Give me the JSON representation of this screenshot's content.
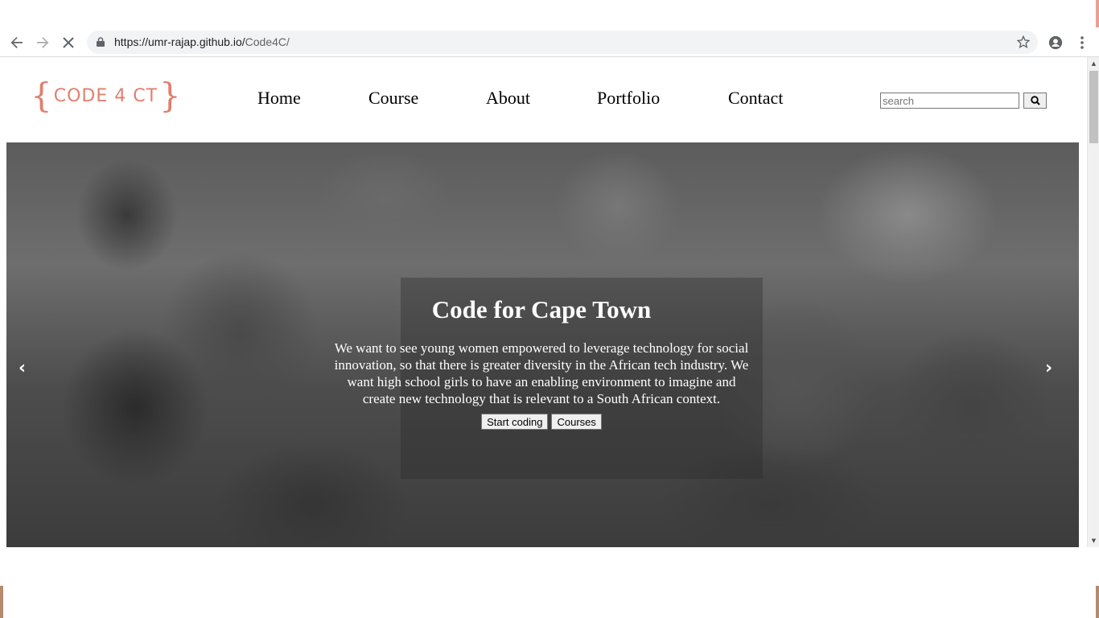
{
  "browser": {
    "url_host": "https://umr-rajap.github.io/",
    "url_path": "Code4C/",
    "icons": [
      "back-icon",
      "forward-icon",
      "stop-loading-icon",
      "lock-icon",
      "star-icon",
      "profile-icon",
      "menu-icon"
    ]
  },
  "header": {
    "logo_text": "CODE 4 CT",
    "logo_open": "{",
    "logo_close": "}",
    "nav": [
      "Home",
      "Course",
      "About",
      "Portfolio",
      "Contact"
    ],
    "search_placeholder": "search",
    "search_icon": "search-icon"
  },
  "hero": {
    "title": "Code for Cape Town",
    "text": "We want to see young women empowered to leverage technology for social innovation, so that there is greater diversity in the African tech industry. We want high school girls to have an enabling environment to imagine and create new technology that is relevant to a South African context.",
    "buttons": [
      "Start coding",
      "Courses"
    ],
    "prev": "‹",
    "next": "›"
  },
  "colors": {
    "logo": "#e07f6e",
    "omnibox": "#f1f3f4"
  }
}
